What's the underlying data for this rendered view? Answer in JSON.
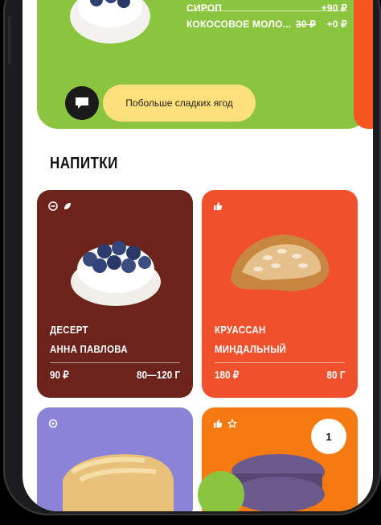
{
  "order": {
    "partial_row": {
      "label": "",
      "value": ""
    },
    "rows": [
      {
        "label": "СИРОП",
        "old_price": "",
        "value": "+90 ₽"
      },
      {
        "label": "КОКОСОВОЕ МОЛО...",
        "old_price": "30 ₽",
        "value": "+0 ₽"
      }
    ],
    "comment": "Побольше сладких ягод",
    "comment_icon": "chat-bubble-icon",
    "accent_color": "#8bc53f"
  },
  "section": {
    "title": "НАПИТКИ"
  },
  "products": [
    {
      "name_line1": "ДЕСЕРТ",
      "name_line2": "АННА ПАВЛОВА",
      "price": "90 ₽",
      "weight": "80—120 Г",
      "icons": [
        "circle-minus-icon",
        "leaf-icon"
      ],
      "color": "#6b231b"
    },
    {
      "name_line1": "КРУАССАН",
      "name_line2": "МИНДАЛЬНЫЙ",
      "price": "180 ₽",
      "weight": "80 Г",
      "icons": [
        "thumbs-up-icon"
      ],
      "color": "#f0502b"
    },
    {
      "icons": [
        "circle-icon"
      ],
      "color": "#8a83d6"
    },
    {
      "icons": [
        "thumbs-up-icon",
        "star-icon"
      ],
      "quantity": "1",
      "color": "#f57a12"
    }
  ]
}
